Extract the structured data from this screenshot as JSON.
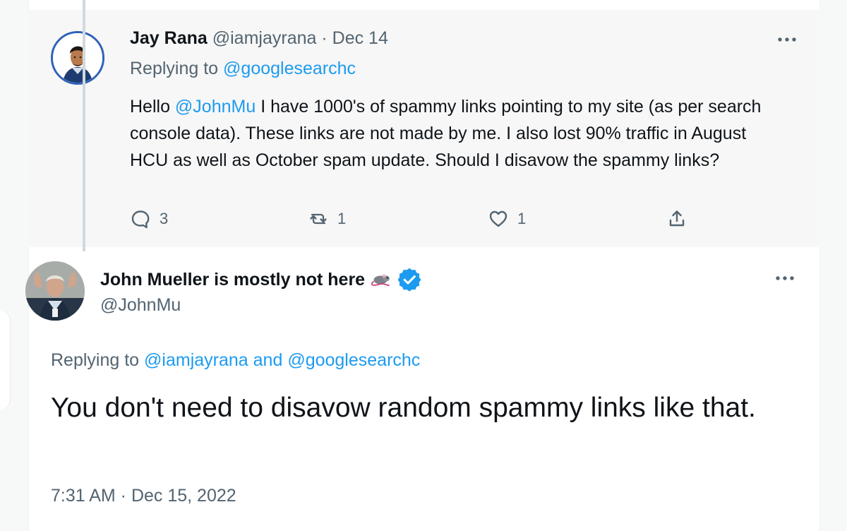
{
  "icons": {
    "reply": "reply-icon",
    "retweet": "retweet-icon",
    "like": "heart-icon",
    "share": "share-icon",
    "more": "more-options-icon",
    "verified": "verified-badge-icon",
    "rat": "rat-emoji-icon"
  },
  "colors": {
    "link_blue": "#1d9bf0",
    "muted_gray": "#536471",
    "verified_blue": "#1d9bf0"
  },
  "parent_tweet": {
    "display_name": "Jay Rana",
    "handle": "@iamjayrana",
    "separator": "·",
    "date": "Dec 14",
    "replying_label": "Replying to",
    "replying_to": "@googlesearchc",
    "text_before_mention": "Hello ",
    "mention": "@JohnMu",
    "text_after_mention": " I have 1000's of spammy links pointing to my site (as per search console data). These links are not made by me. I also lost 90% traffic in August HCU as well as October spam update. Should I disavow the spammy links?",
    "counts": {
      "replies": "3",
      "retweets": "1",
      "likes": "1"
    }
  },
  "reply_tweet": {
    "display_name": "John Mueller is mostly not here",
    "handle": "@JohnMu",
    "replying_label": "Replying to",
    "replying_to_1": "@iamjayrana",
    "replying_join": "and",
    "replying_to_2": "@googlesearchc",
    "text": "You don't need to disavow random spammy links like that.",
    "timestamp": "7:31 AM · Dec 15, 2022"
  }
}
